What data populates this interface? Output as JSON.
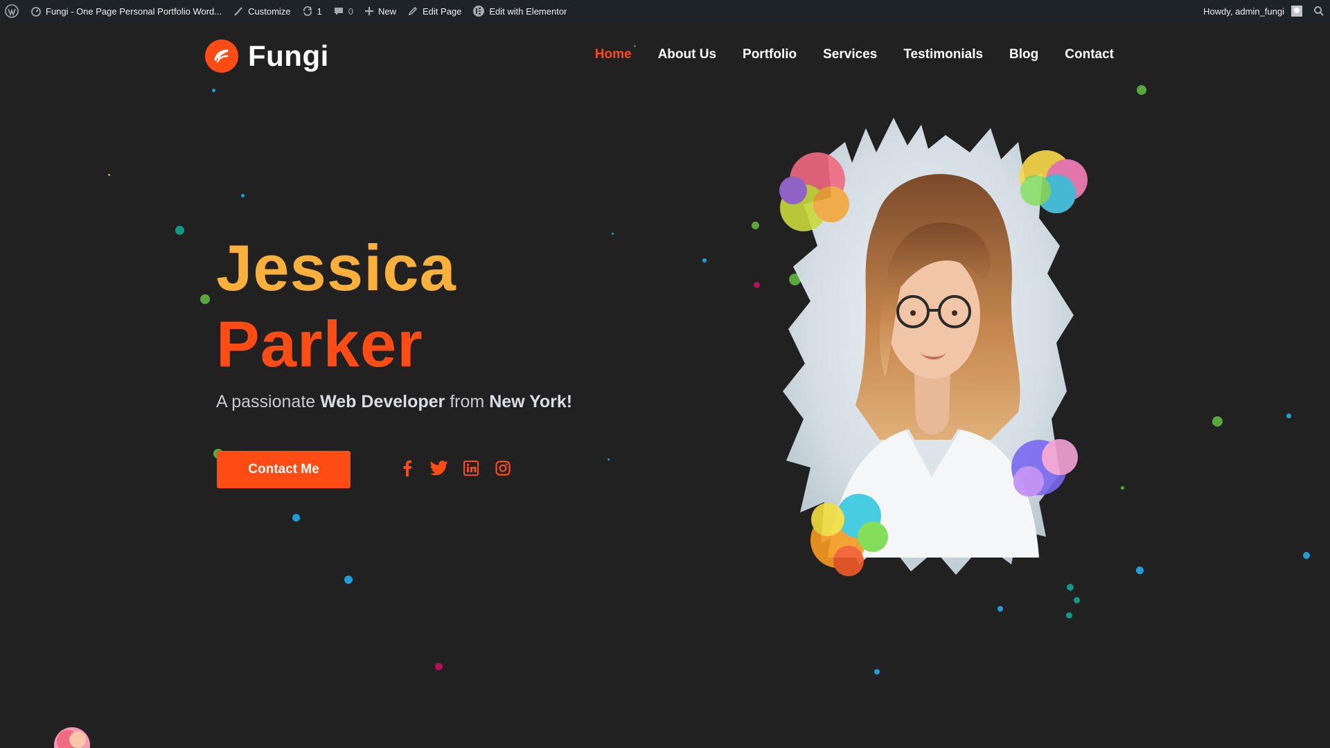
{
  "admin_bar": {
    "site_title": "Fungi - One Page Personal Portfolio Word...",
    "customize": "Customize",
    "updates_count": "1",
    "comments_count": "0",
    "new": "New",
    "edit_page": "Edit Page",
    "edit_elementor": "Edit with Elementor",
    "howdy": "Howdy, admin_fungi"
  },
  "site": {
    "logo_text": "Fungi",
    "nav": [
      "Home",
      "About Us",
      "Portfolio",
      "Services",
      "Testimonials",
      "Blog",
      "Contact"
    ],
    "active_nav": "Home"
  },
  "hero": {
    "first_name": "Jessica",
    "last_name": "Parker",
    "tagline_prefix": "A passionate ",
    "tagline_role": "Web Developer",
    "tagline_mid": " from ",
    "tagline_place": "New York!",
    "cta_label": "Contact Me",
    "socials": [
      "facebook-icon",
      "twitter-icon",
      "linkedin-icon",
      "instagram-icon"
    ]
  },
  "colors": {
    "background": "#212121",
    "accent_orange": "#ff4b14",
    "accent_yellow": "#fbb03b",
    "admin_bar": "#1d2327"
  }
}
